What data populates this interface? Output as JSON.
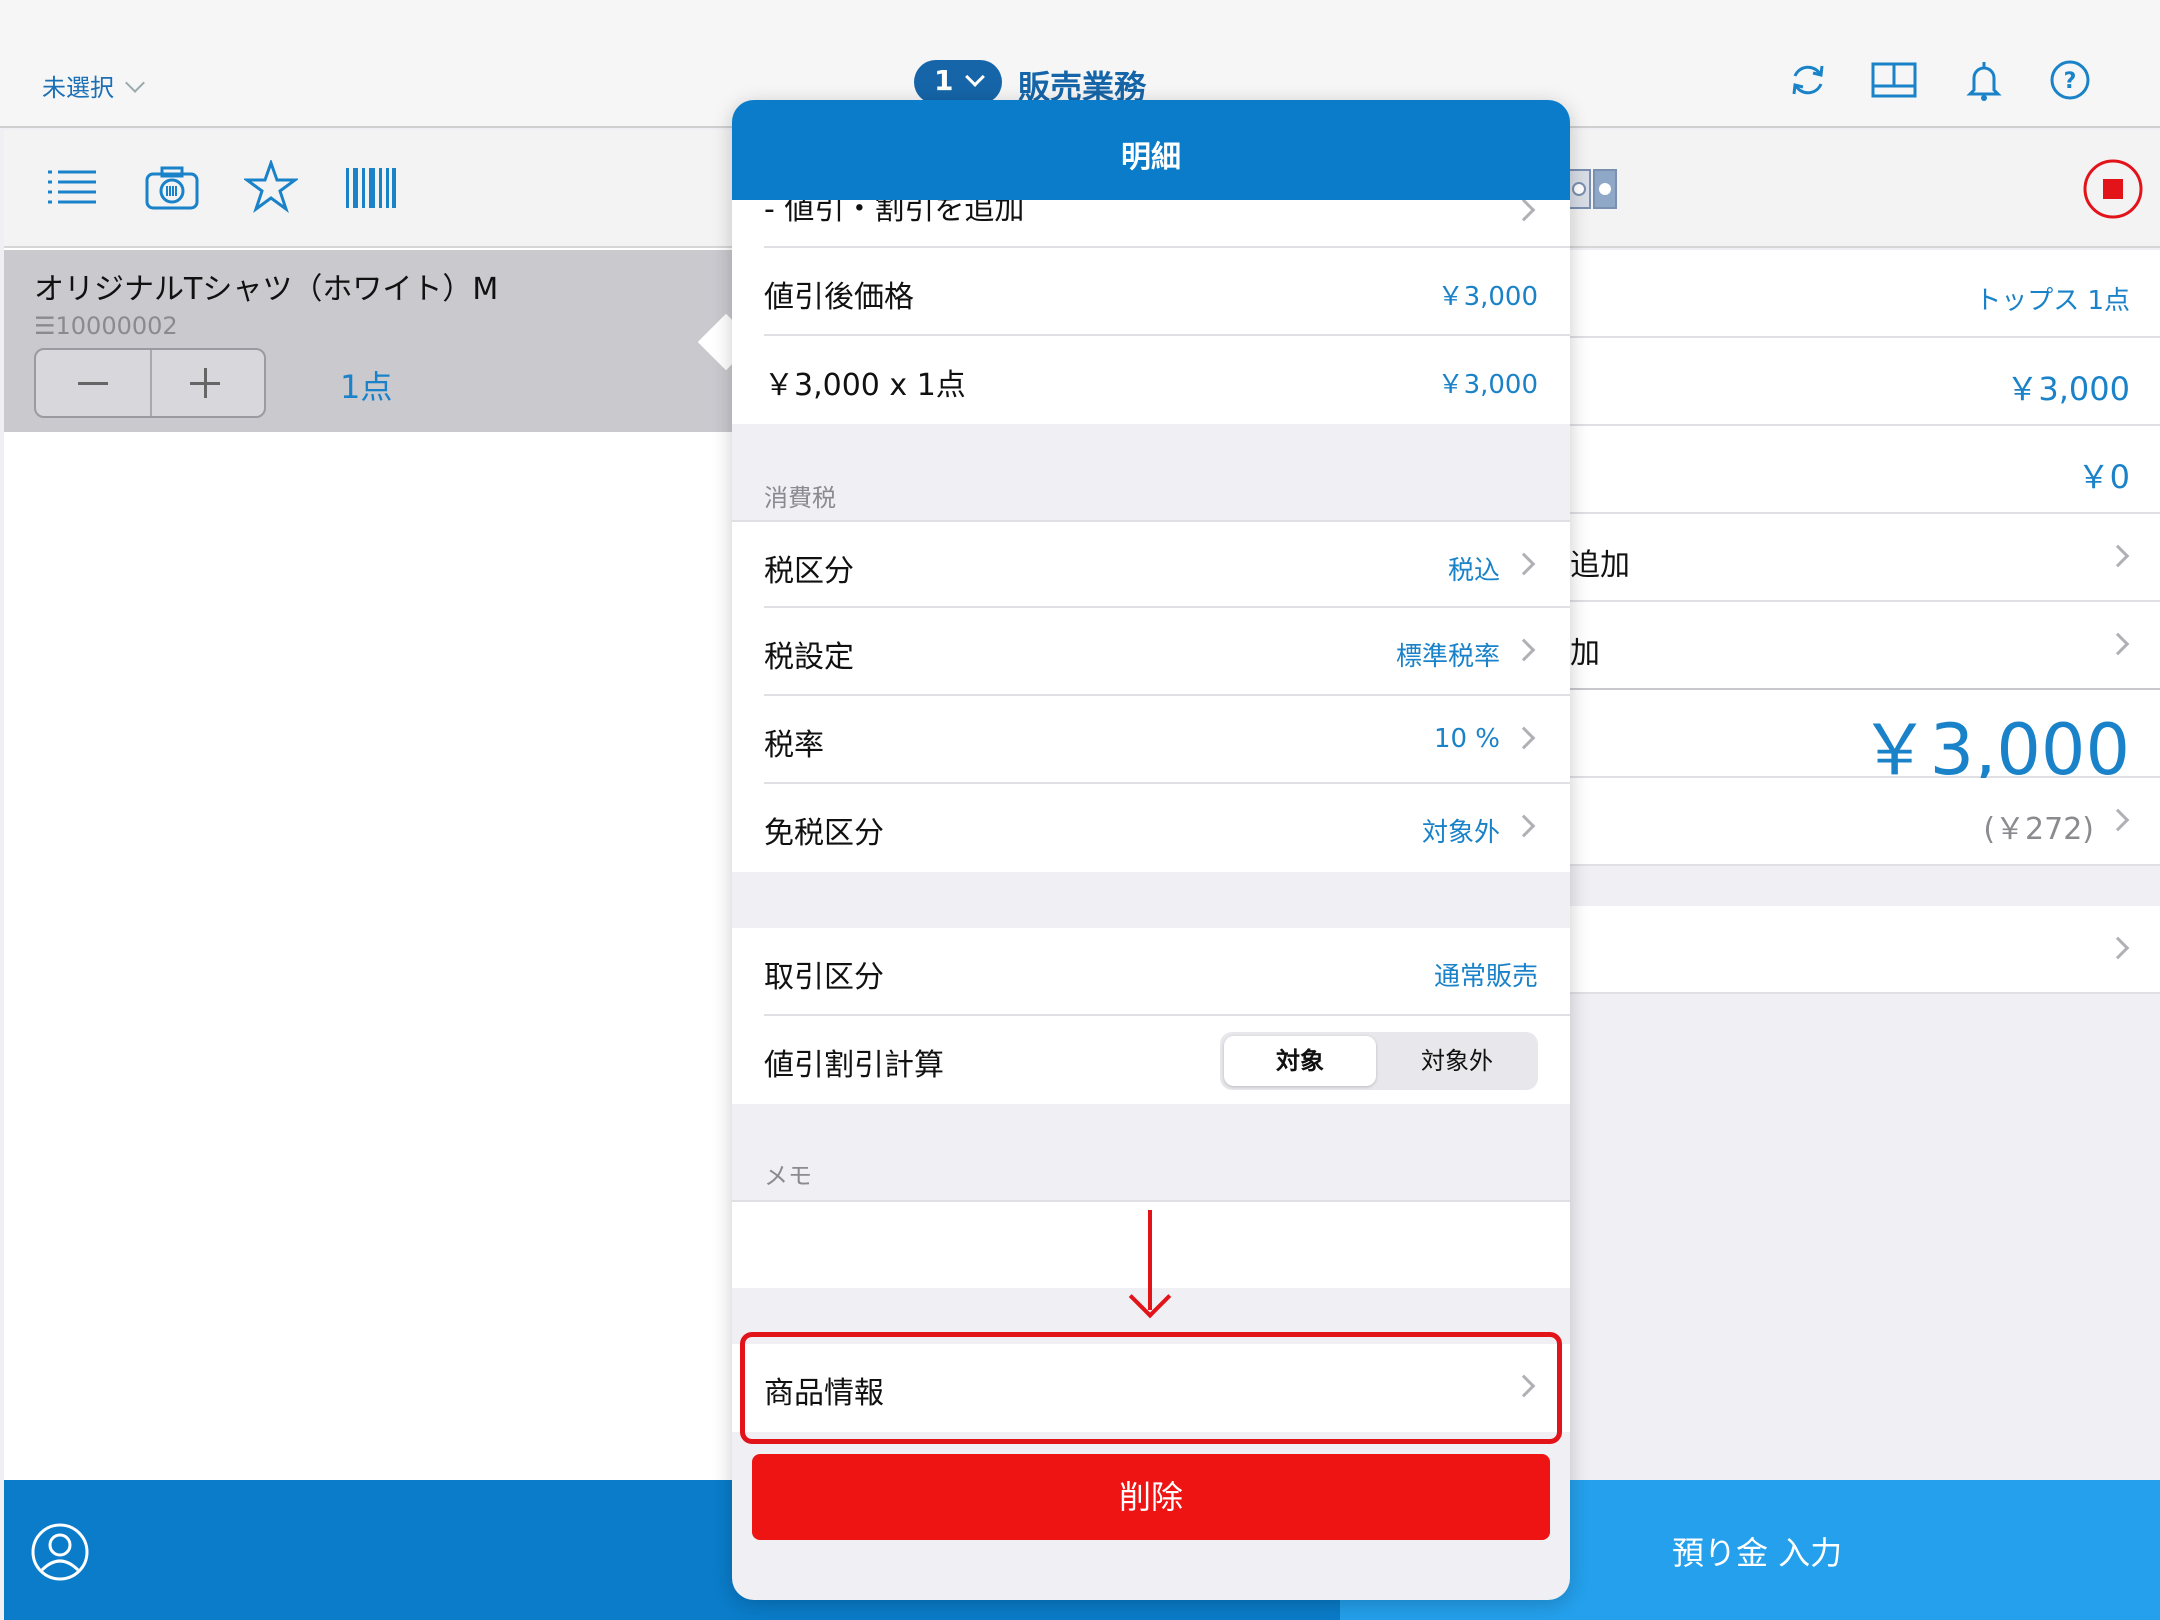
{
  "header": {
    "store_select": "未選択",
    "register_number": "1",
    "mode_title": "販売業務"
  },
  "left": {
    "item": {
      "name": "オリジナルTシャツ（ホワイト）M",
      "code": "☰10000002",
      "quantity": "1点"
    }
  },
  "right": {
    "rows": [
      {
        "value": "トップス 1点"
      },
      {
        "value": "￥3,000"
      },
      {
        "value": "￥0"
      },
      {
        "label": "追加"
      },
      {
        "label": "加"
      },
      {
        "value": "￥3,000"
      },
      {
        "value": "(￥272)"
      }
    ],
    "deposit_button": "預り金 入力"
  },
  "popover": {
    "title": "明細",
    "partial_row": "- 値引・割引を追加",
    "rows_price": [
      {
        "label": "値引後価格",
        "value": "￥3,000"
      },
      {
        "label": "￥3,000 x 1点",
        "value": "￥3,000"
      }
    ],
    "tax_section_label": "消費税",
    "rows_tax": [
      {
        "label": "税区分",
        "value": "税込"
      },
      {
        "label": "税設定",
        "value": "標準税率"
      },
      {
        "label": "税率",
        "value": "10 %"
      },
      {
        "label": "免税区分",
        "value": "対象外"
      }
    ],
    "transaction_row": {
      "label": "取引区分",
      "value": "通常販売"
    },
    "discount_calc": {
      "label": "値引割引計算",
      "option_on": "対象",
      "option_off": "対象外",
      "selected": "対象"
    },
    "memo_section_label": "メモ",
    "memo_value": "",
    "product_info": "商品情報",
    "delete_button": "削除"
  },
  "colors": {
    "accent": "#0a7cc9",
    "link": "#1a82c8",
    "danger": "#ee1414",
    "annotation": "#e2141a"
  }
}
